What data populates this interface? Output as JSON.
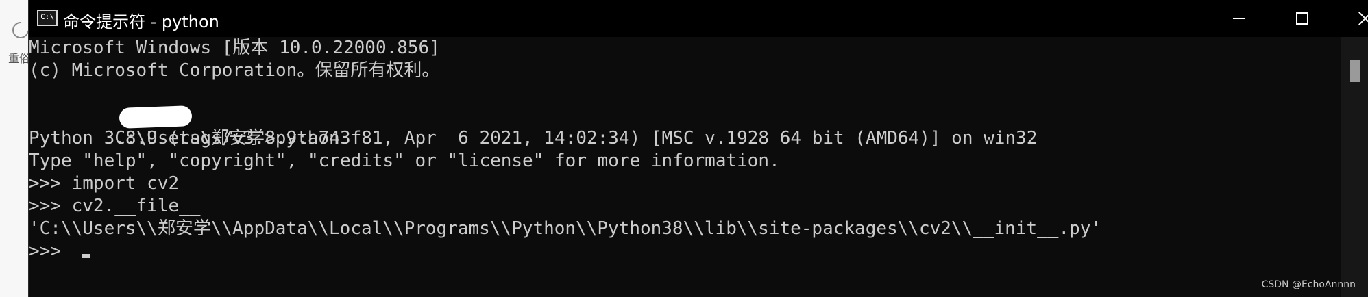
{
  "background_app": {
    "label": "重俗"
  },
  "window": {
    "icon_text": "C:\\",
    "title": "命令提示符 - python"
  },
  "console": {
    "lines": [
      "Microsoft Windows [版本 10.0.22000.856]",
      "(c) Microsoft Corporation。保留所有权利。",
      "",
      "C:\\Users\\郑安学>python",
      "Python 3.8.9 (tags/v3.8.9:a743f81, Apr  6 2021, 14:02:34) [MSC v.1928 64 bit (AMD64)] on win32",
      "Type \"help\", \"copyright\", \"credits\" or \"license\" for more information.",
      ">>> import cv2",
      ">>> cv2.__file__",
      "'C:\\\\Users\\\\郑安学\\\\AppData\\\\Local\\\\Programs\\\\Python\\\\Python38\\\\lib\\\\site-packages\\\\cv2\\\\__init__.py'",
      ">>> "
    ]
  },
  "watermark": "CSDN @EchoAnnnn",
  "icons": {
    "app": "console-icon",
    "minimize": "minimize-icon",
    "maximize": "maximize-icon",
    "close": "close-icon"
  },
  "colors": {
    "console_bg": "#0c0c0c",
    "console_fg": "#cccccc",
    "titlebar_bg": "#000000"
  }
}
